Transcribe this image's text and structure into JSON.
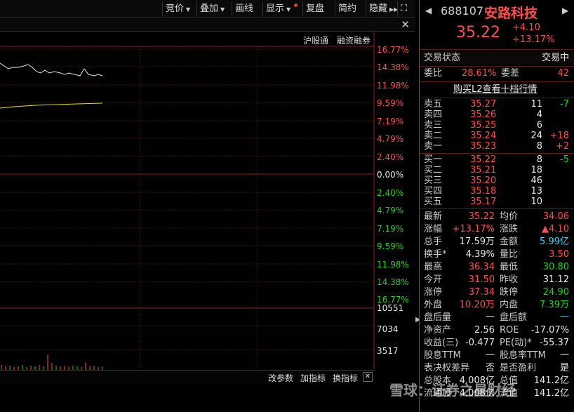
{
  "toolbar": {
    "items": [
      "竞价",
      "叠加",
      "画线",
      "显示",
      "复盘",
      "简约",
      "隐藏"
    ],
    "expand": "⛶"
  },
  "subheader": {
    "close": "✕",
    "tab1": "沪股通",
    "tab2": "融资融券"
  },
  "chart": {
    "pct_labels": [
      "16.77%",
      "14.38%",
      "11.98%",
      "9.59%",
      "7.19%",
      "4.79%",
      "2.40%",
      "0.00%",
      "2.40%",
      "4.79%",
      "7.19%",
      "9.59%",
      "11.98%",
      "14.38%",
      "16.77%"
    ],
    "volume_labels": [
      "10551",
      "7034",
      "3517"
    ]
  },
  "bottombar": {
    "a": "改参数",
    "b": "加指标",
    "c": "换指标",
    "close": "✕"
  },
  "stock": {
    "code": "688107",
    "name": "安路科技",
    "price": "35.22",
    "change": "+4.10",
    "change_pct": "+13.17%"
  },
  "status": {
    "label": "交易状态",
    "value": "交易中"
  },
  "weibi": {
    "label1": "委比",
    "val1": "28.61%",
    "label2": "委差",
    "val2": "42"
  },
  "l2_link": "购买L2查看十档行情",
  "asks": [
    {
      "label": "卖五",
      "price": "35.27",
      "vol": "11",
      "chg": "-7",
      "chg_color": "green"
    },
    {
      "label": "卖四",
      "price": "35.26",
      "vol": "4",
      "chg": "",
      "chg_color": ""
    },
    {
      "label": "卖三",
      "price": "35.25",
      "vol": "6",
      "chg": "",
      "chg_color": ""
    },
    {
      "label": "卖二",
      "price": "35.24",
      "vol": "24",
      "chg": "+18",
      "chg_color": "red"
    },
    {
      "label": "卖一",
      "price": "35.23",
      "vol": "8",
      "chg": "+2",
      "chg_color": "red"
    }
  ],
  "bids": [
    {
      "label": "买一",
      "price": "35.22",
      "vol": "8",
      "chg": "-5",
      "chg_color": "green"
    },
    {
      "label": "买二",
      "price": "35.21",
      "vol": "18",
      "chg": "",
      "chg_color": ""
    },
    {
      "label": "买三",
      "price": "35.20",
      "vol": "46",
      "chg": "",
      "chg_color": ""
    },
    {
      "label": "买四",
      "price": "35.18",
      "vol": "13",
      "chg": "",
      "chg_color": ""
    },
    {
      "label": "买五",
      "price": "35.17",
      "vol": "10",
      "chg": "",
      "chg_color": ""
    }
  ],
  "stats": [
    {
      "l1": "最新",
      "v1": "35.22",
      "c1": "red",
      "l2": "均价",
      "v2": "34.06",
      "c2": "red"
    },
    {
      "l1": "涨幅",
      "v1": "+13.17%",
      "c1": "red",
      "l2": "涨跌",
      "v2": "▲4.10",
      "c2": "red"
    },
    {
      "l1": "总手",
      "v1": "17.59万",
      "c1": "white",
      "l2": "金额",
      "v2": "5.99亿",
      "c2": "cyan"
    },
    {
      "l1": "换手*",
      "v1": "4.39%",
      "c1": "white",
      "l2": "量比",
      "v2": "3.50",
      "c2": "red"
    },
    {
      "l1": "最高",
      "v1": "36.34",
      "c1": "red",
      "l2": "最低",
      "v2": "30.80",
      "c2": "green"
    },
    {
      "l1": "今开",
      "v1": "31.50",
      "c1": "red",
      "l2": "昨收",
      "v2": "31.12",
      "c2": "white"
    },
    {
      "l1": "涨停",
      "v1": "37.34",
      "c1": "red",
      "l2": "跌停",
      "v2": "24.90",
      "c2": "green"
    },
    {
      "l1": "外盘",
      "v1": "10.20万",
      "c1": "red",
      "l2": "内盘",
      "v2": "7.39万",
      "c2": "green"
    },
    {
      "l1": "盘后量",
      "v1": "一",
      "c1": "white",
      "l2": "盘后额",
      "v2": "一",
      "c2": "cyan"
    },
    {
      "l1": "净资产",
      "v1": "2.56",
      "c1": "white",
      "l2": "ROE",
      "v2": "-17.07%",
      "c2": "white"
    },
    {
      "l1": "收益(三)",
      "v1": "-0.477",
      "c1": "white",
      "l2": "PE(动)*",
      "v2": "-55.37",
      "c2": "white"
    },
    {
      "l1": "股息TTM",
      "v1": "一",
      "c1": "white",
      "l2": "股息率TTM",
      "v2": "一",
      "c2": "white"
    },
    {
      "l1": "表决权差异",
      "v1": "否",
      "c1": "white",
      "l2": "是否盈利",
      "v2": "是",
      "c2": "white"
    },
    {
      "l1": "总股本",
      "v1": "4.008亿",
      "c1": "white",
      "l2": "总值",
      "v2": "141.2亿",
      "c2": "white"
    },
    {
      "l1": "流通股",
      "v1": "4.008亿",
      "c1": "white",
      "l2": "流值",
      "v2": "141.2亿",
      "c2": "white"
    }
  ],
  "watermark": "雪球：证券之星财经"
}
